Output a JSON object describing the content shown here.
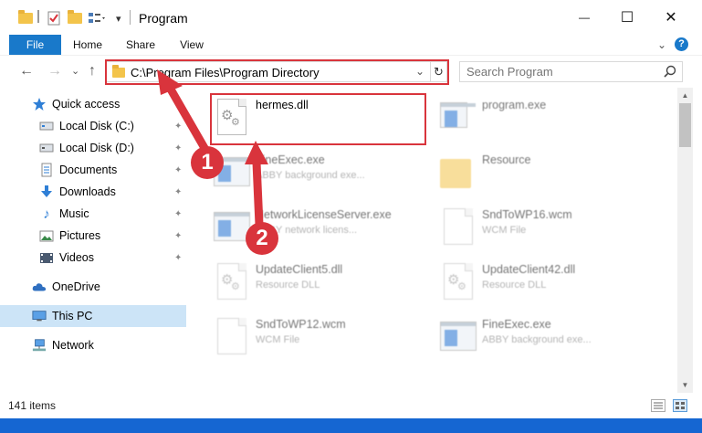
{
  "window": {
    "title": "Program",
    "minimize_glyph": "—",
    "maximize_glyph": "☐",
    "close_glyph": "✕"
  },
  "ribbon": {
    "tabs": [
      "File",
      "Home",
      "Share",
      "View"
    ],
    "help_glyph": "?",
    "collapse_glyph": "⌄"
  },
  "address": {
    "back_glyph": "←",
    "forward_glyph": "→",
    "recent_glyph": "⌄",
    "up_glyph": "↑",
    "path": "C:\\Program Files\\Program Directory",
    "dropdown_glyph": "⌄",
    "refresh_glyph": "↻"
  },
  "search": {
    "placeholder": "Search Program",
    "icon": "search-icon"
  },
  "sidebar": {
    "items": [
      {
        "label": "Quick access",
        "icon": "star-icon",
        "pinned": false
      },
      {
        "label": "Local Disk (C:)",
        "icon": "drive-icon",
        "pinned": true
      },
      {
        "label": "Local Disk (D:)",
        "icon": "drive-icon",
        "pinned": true
      },
      {
        "label": "Documents",
        "icon": "documents-icon",
        "pinned": true
      },
      {
        "label": "Downloads",
        "icon": "download-icon",
        "pinned": true
      },
      {
        "label": "Music",
        "icon": "music-icon",
        "pinned": true
      },
      {
        "label": "Pictures",
        "icon": "pictures-icon",
        "pinned": true
      },
      {
        "label": "Videos",
        "icon": "videos-icon",
        "pinned": true
      },
      {
        "label": "OneDrive",
        "icon": "cloud-icon",
        "pinned": false
      },
      {
        "label": "This PC",
        "icon": "computer-icon",
        "pinned": false,
        "selected": true
      },
      {
        "label": "Network",
        "icon": "network-icon",
        "pinned": false
      }
    ],
    "pin_glyph": "📌"
  },
  "files": [
    {
      "name": "hermes.dll",
      "desc": "",
      "icon": "dll-file-icon",
      "highlighted": true
    },
    {
      "name": "program.exe",
      "desc": "",
      "icon": "exe-file-icon"
    },
    {
      "name": "FineExec.exe",
      "desc": "ABBY background exe...",
      "icon": "exe-file-icon"
    },
    {
      "name": "Resource",
      "desc": "",
      "icon": "folder-icon"
    },
    {
      "name": "NetworkLicenseServer.exe",
      "desc": "ABBY network licens...",
      "icon": "exe-file-icon"
    },
    {
      "name": "SndToWP16.wcm",
      "desc": "WCM File",
      "icon": "blank-file-icon"
    },
    {
      "name": "UpdateClient5.dll",
      "desc": "Resource DLL",
      "icon": "dll-file-icon"
    },
    {
      "name": "UpdateClient42.dll",
      "desc": "Resource DLL",
      "icon": "dll-file-icon"
    },
    {
      "name": "SndToWP12.wcm",
      "desc": "WCM File",
      "icon": "blank-file-icon"
    },
    {
      "name": "FineExec.exe",
      "desc": "ABBY background exe...",
      "icon": "exe-file-icon"
    }
  ],
  "status": {
    "item_count": "141 items"
  },
  "annotations": {
    "step1": "1",
    "step2": "2",
    "color": "#d9343c"
  },
  "colors": {
    "accent": "#1979ca",
    "selection": "#cce4f7",
    "taskbar": "#1566d2"
  }
}
